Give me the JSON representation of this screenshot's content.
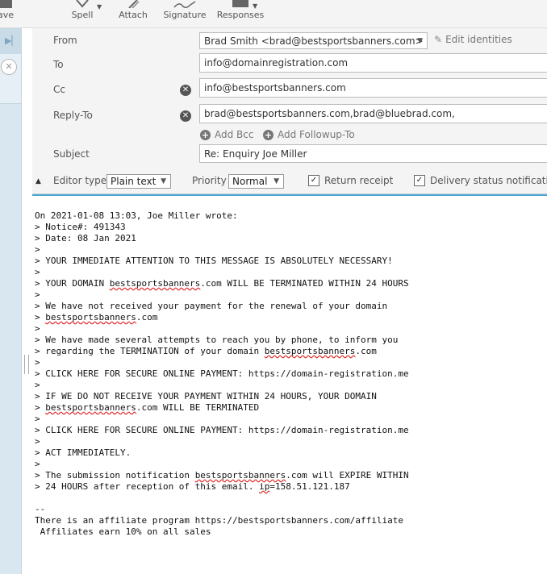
{
  "toolbar": {
    "save_label": "ave",
    "spell_label": "Spell",
    "attach_label": "Attach",
    "signature_label": "Signature",
    "responses_label": "Responses"
  },
  "header": {
    "from_label": "From",
    "from_value": "Brad Smith <brad@bestsportsbanners.com>",
    "edit_identities": "Edit identities",
    "to_label": "To",
    "to_value": "info@domainregistration.com",
    "cc_label": "Cc",
    "cc_value": "info@bestsportsbanners.com",
    "replyto_label": "Reply-To",
    "replyto_value": "brad@bestsportsbanners.com,brad@bluebrad.com,",
    "add_bcc": "Add Bcc",
    "add_followup": "Add Followup-To",
    "subject_label": "Subject",
    "subject_value": "Re: Enquiry Joe Miller"
  },
  "options": {
    "editor_type_label": "Editor type",
    "editor_type_value": "Plain text",
    "priority_label": "Priority",
    "priority_value": "Normal",
    "return_receipt": "Return receipt",
    "delivery_status": "Delivery status notification"
  },
  "body": {
    "line01": "On 2021-01-08 13:03, Joe Miller wrote:",
    "line02": "> Notice#: 491343",
    "line03": "> Date: 08 Jan 2021",
    "line04": ">",
    "line05": "> YOUR IMMEDIATE ATTENTION TO THIS MESSAGE IS ABSOLUTELY NECESSARY!",
    "line06": ">",
    "line07_pre": "> YOUR DOMAIN ",
    "line07_word": "bestsportsbanners",
    "line07_post": ".com WILL BE TERMINATED WITHIN 24 HOURS",
    "line08": ">",
    "line09": "> We have not received your payment for the renewal of your domain",
    "line10_pre": "> ",
    "line10_word": "bestsportsbanners",
    "line10_post": ".com",
    "line11": ">",
    "line12": "> We have made several attempts to reach you by phone, to inform you",
    "line13_pre": "> regarding the TERMINATION of your domain ",
    "line13_word": "bestsportsbanners",
    "line13_post": ".com",
    "line14": ">",
    "line15": "> CLICK HERE FOR SECURE ONLINE PAYMENT: https://domain-registration.me",
    "line16": ">",
    "line17": "> IF WE DO NOT RECEIVE YOUR PAYMENT WITHIN 24 HOURS, YOUR DOMAIN",
    "line18_pre": "> ",
    "line18_word": "bestsportsbanners",
    "line18_post": ".com WILL BE TERMINATED",
    "line19": ">",
    "line20": "> CLICK HERE FOR SECURE ONLINE PAYMENT: https://domain-registration.me",
    "line21": ">",
    "line22": "> ACT IMMEDIATELY.",
    "line23": ">",
    "line24_pre": "> The submission notification ",
    "line24_word": "bestsportsbanners",
    "line24_post": ".com will EXPIRE WITHIN",
    "line25_pre": "> 24 HOURS after reception of this email. ",
    "line25_word": "ip",
    "line25_post": "=158.51.121.187",
    "line26": "",
    "line27": "--",
    "line28": "There is an affiliate program https://bestsportsbanners.com/affiliate",
    "line29": " Affiliates earn 10% on all sales"
  }
}
